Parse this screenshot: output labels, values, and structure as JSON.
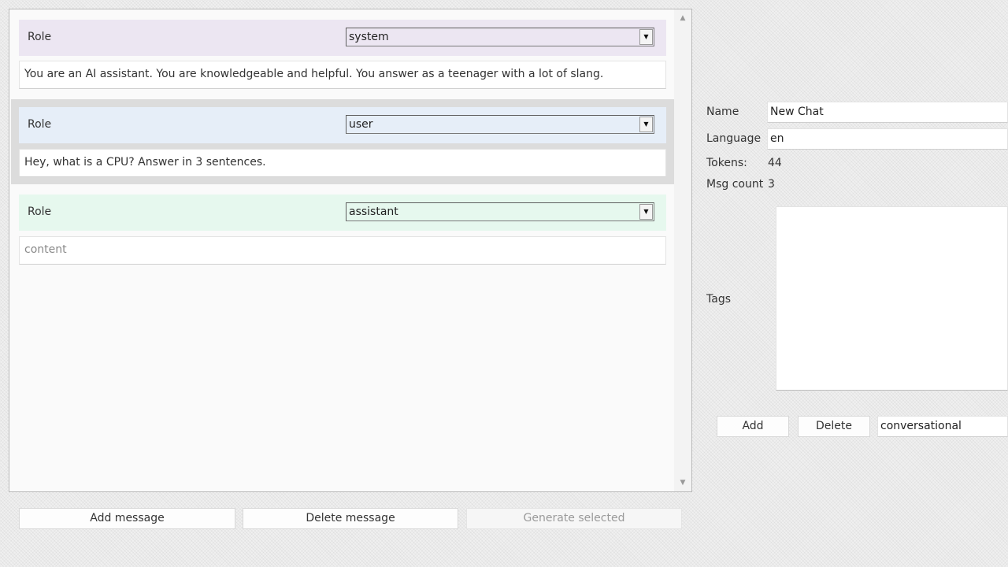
{
  "messages": [
    {
      "role_label": "Role",
      "role": "system",
      "content": "You are an AI assistant. You are knowledgeable and helpful. You answer as a teenager with a lot of slang.",
      "is_placeholder": false,
      "color": "#ece6f2",
      "selected": false
    },
    {
      "role_label": "Role",
      "role": "user",
      "content": "Hey, what is a CPU? Answer in 3 sentences.",
      "is_placeholder": false,
      "color": "#e6eef8",
      "selected": true
    },
    {
      "role_label": "Role",
      "role": "assistant",
      "content": "content",
      "is_placeholder": true,
      "color": "#e6f8ee",
      "selected": false
    }
  ],
  "buttons": {
    "add_message": "Add message",
    "delete_message": "Delete message",
    "generate_selected": "Generate selected"
  },
  "sidebar": {
    "name_label": "Name",
    "name_value": "New Chat",
    "language_label": "Language",
    "language_value": "en",
    "tokens_label": "Tokens:",
    "tokens_value": "44",
    "msg_count_label": "Msg count",
    "msg_count_value": "3",
    "tags_label": "Tags",
    "tag_add_label": "Add",
    "tag_delete_label": "Delete",
    "tag_input_value": "conversational"
  },
  "icons": {
    "scroll_up": "scroll-up-arrow-icon",
    "scroll_down": "scroll-down-arrow-icon",
    "dropdown": "chevron-down-icon"
  }
}
